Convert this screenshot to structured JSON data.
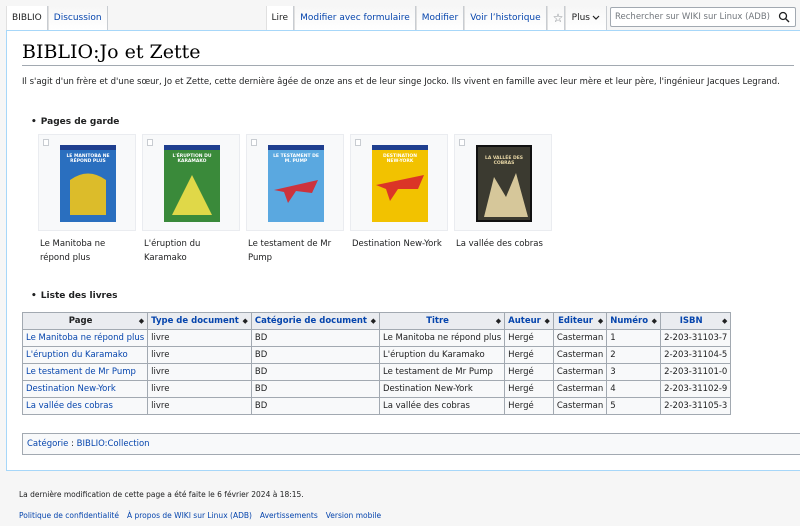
{
  "tabs_left": [
    {
      "label": "BIBLIO"
    },
    {
      "label": "Discussion"
    }
  ],
  "tabs_right": [
    {
      "label": "Lire"
    },
    {
      "label": "Modifier avec formulaire"
    },
    {
      "label": "Modifier"
    },
    {
      "label": "Voir l’historique"
    }
  ],
  "more_label": "Plus",
  "search": {
    "placeholder": "Rechercher sur WIKI sur Linux (ADB)"
  },
  "page": {
    "title": "BIBLIO:Jo et Zette",
    "intro": "Il s'agit d'un frère et d'une sœur, Jo et Zette, cette dernière âgée de onze ans et de leur singe Jocko. Ils vivent en famille avec leur mère et leur père, l'ingénieur Jacques Legrand."
  },
  "gallery": {
    "heading": "Pages de garde",
    "items": [
      {
        "caption": "Le Manitoba ne répond plus",
        "cover_text": "LE MANITOBA NE RÉPOND PLUS",
        "bg": "#2a6fbf",
        "accent": "#f0c419"
      },
      {
        "caption": "L'éruption du Karamako",
        "cover_text": "L'ÉRUPTION DU KARAMAKO",
        "bg": "#3a8a3a",
        "accent": "#f3e04a"
      },
      {
        "caption": "Le testament de Mr Pump",
        "cover_text": "LE TESTAMENT DE M. PUMP",
        "bg": "#5aa8e0",
        "accent": "#d8262b"
      },
      {
        "caption": "Destination New-York",
        "cover_text": "DESTINATION NEW-YORK",
        "bg": "#f2c200",
        "accent": "#d8262b"
      },
      {
        "caption": "La vallée des cobras",
        "cover_text": "LA VALLÉE DES COBRAS",
        "bg": "#3b3a30",
        "accent": "#e8d7a6"
      }
    ]
  },
  "books": {
    "heading": "Liste des livres",
    "columns": [
      "Page",
      "Type de document",
      "Catégorie de document",
      "Titre",
      "Auteur",
      "Editeur",
      "Numéro",
      "ISBN"
    ],
    "rows": [
      [
        "Le Manitoba ne répond plus",
        "livre",
        "BD",
        "Le Manitoba ne répond plus",
        "Hergé",
        "Casterman",
        "1",
        "2-203-31103-7"
      ],
      [
        "L'éruption du Karamako",
        "livre",
        "BD",
        "L'éruption du Karamako",
        "Hergé",
        "Casterman",
        "2",
        "2-203-31104-5"
      ],
      [
        "Le testament de Mr Pump",
        "livre",
        "BD",
        "Le testament de Mr Pump",
        "Hergé",
        "Casterman",
        "3",
        "2-203-31101-0"
      ],
      [
        "Destination New-York",
        "livre",
        "BD",
        "Destination New-York",
        "Hergé",
        "Casterman",
        "4",
        "2-203-31102-9"
      ],
      [
        "La vallée des cobras",
        "livre",
        "BD",
        "La vallée des cobras",
        "Hergé",
        "Casterman",
        "5",
        "2-203-31105-3"
      ]
    ]
  },
  "categories": {
    "label": "Catégorie",
    "separator": " : ",
    "items": [
      "BIBLIO:Collection"
    ]
  },
  "footer": {
    "last_modified": "La dernière modification de cette page a été faite le 6 février 2024 à 18:15.",
    "links": [
      "Politique de confidentialité",
      "À propos de WIKI sur Linux (ADB)",
      "Avertissements",
      "Version mobile"
    ]
  },
  "colors": {
    "link": "#0645ad",
    "border": "#a2a9b1",
    "header_bg": "#eaecf0",
    "content_border": "#a7d7f9"
  }
}
